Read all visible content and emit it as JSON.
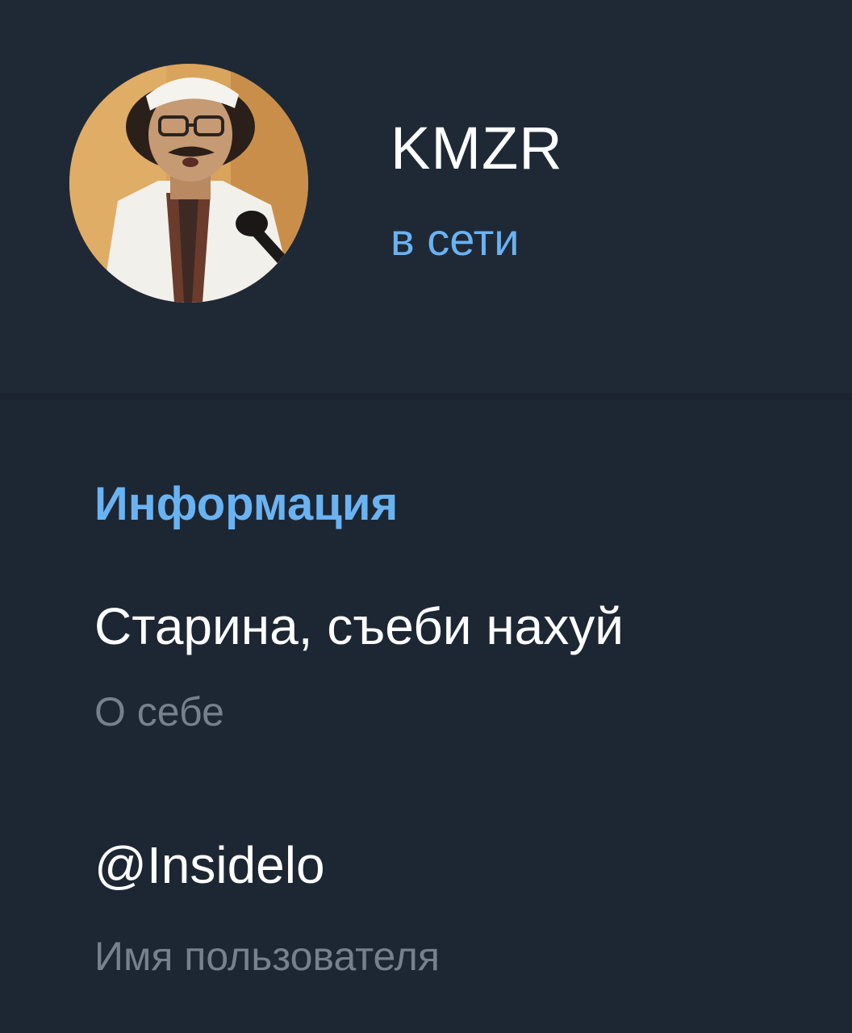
{
  "profile": {
    "name": "KMZR",
    "status": "в сети",
    "avatar_icon": "user-photo-avatar"
  },
  "info": {
    "section_title": "Информация",
    "bio": {
      "value": "Старина, съеби нахуй",
      "label": "О себе"
    },
    "username": {
      "value": "@Insidelo",
      "label": "Имя пользователя"
    }
  },
  "colors": {
    "background": "#1d2733",
    "header_background": "#1f2936",
    "accent": "#6ab3f3",
    "primary_text": "#ffffff",
    "secondary_text": "#77818d"
  }
}
